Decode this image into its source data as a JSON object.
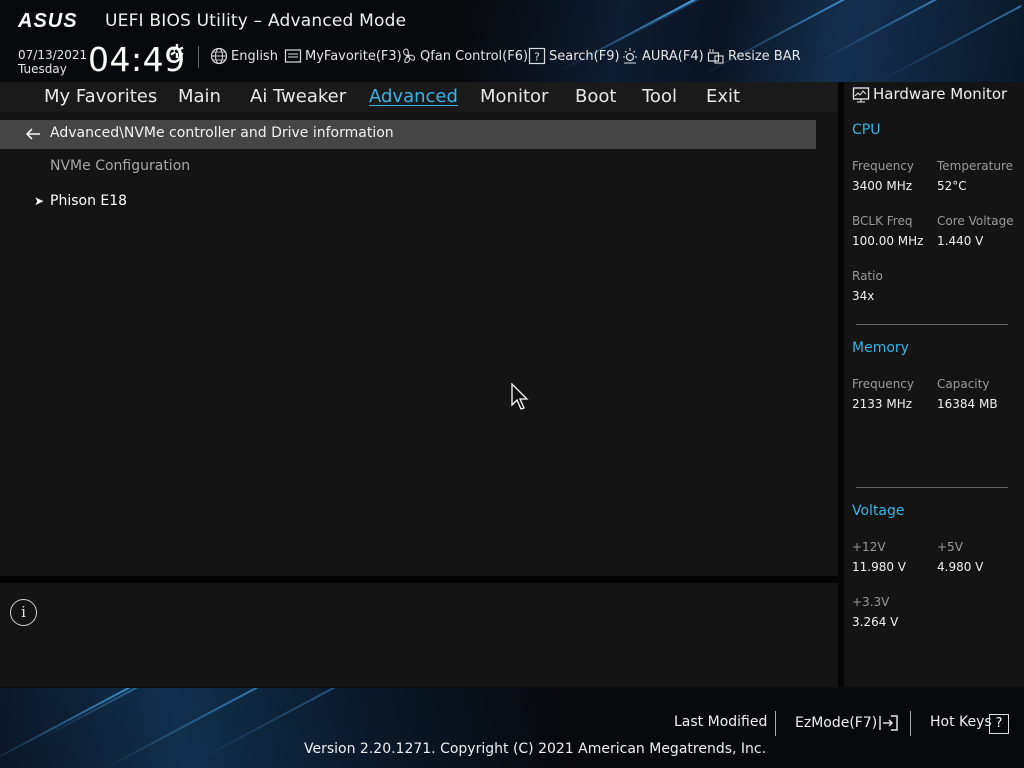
{
  "header": {
    "title": "UEFI BIOS Utility – Advanced Mode",
    "date": "07/13/2021",
    "weekday": "Tuesday",
    "time": "04:49",
    "toolbar": {
      "language": "English",
      "myfavorite": "MyFavorite(F3)",
      "qfan": "Qfan Control(F6)",
      "search": "Search(F9)",
      "aura": "AURA(F4)",
      "resizebar": "Resize BAR"
    }
  },
  "nav": {
    "tabs": [
      "My Favorites",
      "Main",
      "Ai Tweaker",
      "Advanced",
      "Monitor",
      "Boot",
      "Tool",
      "Exit"
    ],
    "active": "Advanced"
  },
  "main": {
    "breadcrumb": "Advanced\\NVMe controller and Drive information",
    "section_label": "NVMe Configuration",
    "items": [
      "Phison E18"
    ]
  },
  "hardware_monitor": {
    "title": "Hardware Monitor",
    "cpu": {
      "heading": "CPU",
      "frequency_label": "Frequency",
      "frequency": "3400 MHz",
      "temperature_label": "Temperature",
      "temperature": "52°C",
      "bclk_label": "BCLK Freq",
      "bclk": "100.00 MHz",
      "core_voltage_label": "Core Voltage",
      "core_voltage": "1.440 V",
      "ratio_label": "Ratio",
      "ratio": "34x"
    },
    "memory": {
      "heading": "Memory",
      "frequency_label": "Frequency",
      "frequency": "2133 MHz",
      "capacity_label": "Capacity",
      "capacity": "16384 MB"
    },
    "voltage": {
      "heading": "Voltage",
      "v12_label": "+12V",
      "v12": "11.980 V",
      "v5_label": "+5V",
      "v5": "4.980 V",
      "v33_label": "+3.3V",
      "v33": "3.264 V"
    }
  },
  "footer": {
    "last_modified": "Last Modified",
    "ezmode": "EzMode(F7)",
    "hotkeys": "Hot Keys",
    "hotkeys_key": "?",
    "version": "Version 2.20.1271. Copyright (C) 2021 American Megatrends, Inc."
  },
  "icons": {
    "info": "i"
  },
  "colors": {
    "accent": "#35b5e8",
    "breadcrumb_bg": "#454545",
    "panel_bg": "#141414"
  }
}
